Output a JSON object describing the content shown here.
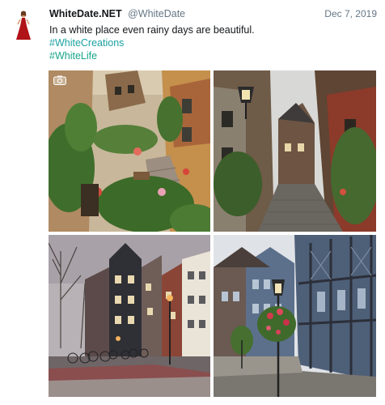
{
  "tweet": {
    "author_name": "WhiteDate.NET",
    "author_handle": "@WhiteDate",
    "date": "Dec 7, 2019",
    "text": "In a white place even rainy days are beautiful.",
    "hashtags": [
      "#WhiteCreations",
      "#WhiteLife"
    ]
  },
  "icons": {
    "avatar": "woman-in-red-dress-avatar",
    "badge": "camera-icon"
  },
  "colors": {
    "hashtag": "#1da1a1",
    "muted": "#657786",
    "text": "#14171a"
  }
}
